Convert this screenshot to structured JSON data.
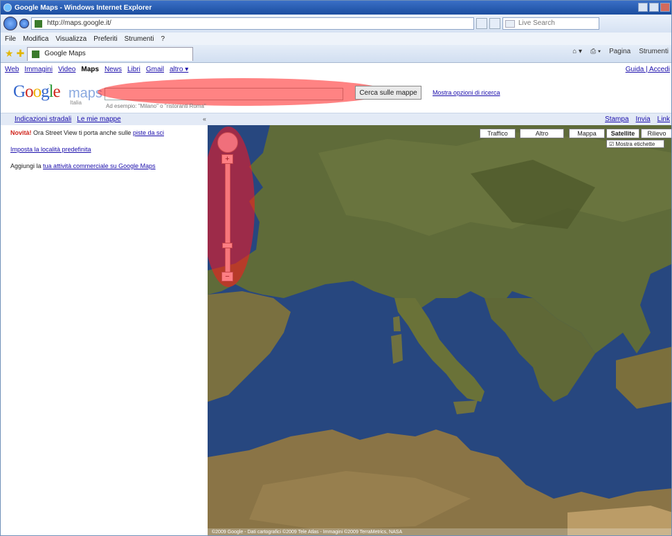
{
  "window": {
    "title": "Google Maps - Windows Internet Explorer"
  },
  "address_bar": {
    "url": "http://maps.google.it/",
    "search_placeholder": "Live Search"
  },
  "menu": [
    "File",
    "Modifica",
    "Visualizza",
    "Preferiti",
    "Strumenti",
    "?"
  ],
  "tab": {
    "label": "Google Maps"
  },
  "command_bar": [
    "Pagina",
    "Strumenti"
  ],
  "gbar": {
    "links": [
      "Web",
      "Immagini",
      "Video",
      "Maps",
      "News",
      "Libri",
      "Gmail",
      "altro ▾"
    ],
    "current": "Maps",
    "user_links": "Guida | Accedi"
  },
  "logo": {
    "maps": "maps",
    "sub": "Italia"
  },
  "search": {
    "button": "Cerca sulle mappe",
    "options": "Mostra opzioni di ricerca",
    "hint": "Ad esempio: \"Milano\" o \"ristoranti Roma\""
  },
  "subbar": {
    "links": [
      "Indicazioni stradali",
      "Le mie mappe"
    ],
    "collapse": "«",
    "right_links": [
      "Stampa",
      "Invia",
      "Link"
    ]
  },
  "sidebar": {
    "news_label": "Novità!",
    "news_text": "Ora Street View ti porta anche sulle ",
    "news_link": "piste da sci",
    "locations_link": "Imposta la località predefinita",
    "add_text": "Aggiungi la ",
    "add_link": "tua attività commerciale su Google Maps"
  },
  "map": {
    "types": [
      "Traffico",
      "Altro",
      "Mappa",
      "Satellite",
      "Rilievo"
    ],
    "labels_check": "Mostra etichette",
    "zoom_plus": "+",
    "zoom_minus": "−",
    "footer": "©2009 Google - Dati cartografici ©2009 Tele Atlas - Immagini ©2009 TerraMetrics, NASA"
  },
  "colors": {
    "annotation": "#ff1e1e",
    "link": "#1a0dab"
  }
}
